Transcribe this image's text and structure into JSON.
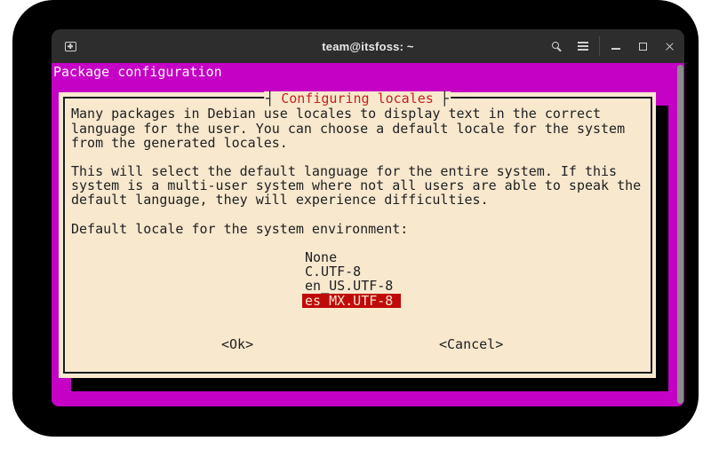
{
  "window": {
    "title": "team@itsfoss: ~",
    "icons": {
      "new_tab": "new-tab-icon",
      "search": "search-icon",
      "menu": "hamburger-menu-icon",
      "minimize": "minimize-icon",
      "maximize": "maximize-icon",
      "close": "close-icon"
    }
  },
  "terminal": {
    "header": "Package configuration",
    "dialog": {
      "title": "Configuring locales",
      "tick_left": "┤",
      "tick_right": "├",
      "body_lines": [
        "Many packages in Debian use locales to display text in the correct",
        "language for the user. You can choose a default locale for the system",
        "from the generated locales.",
        "",
        "This will select the default language for the entire system. If this",
        "system is a multi-user system where not all users are able to speak the",
        "default language, they will experience difficulties.",
        "",
        "Default locale for the system environment:"
      ],
      "options": [
        {
          "label": "None",
          "selected": false
        },
        {
          "label": "C.UTF-8",
          "selected": false
        },
        {
          "label": "en_US.UTF-8",
          "selected": false
        },
        {
          "label": "es_MX.UTF-8",
          "selected": true
        }
      ],
      "ok_label": "<Ok>",
      "cancel_label": "<Cancel>"
    }
  },
  "colors": {
    "backdrop": "#000000",
    "titlebar-bg": "#2d2d2d",
    "titlebar-text": "#e8e8e8",
    "magenta": "#c401c4",
    "header-text": "#fdf8fd",
    "dialog-bg": "#f7e8ce",
    "dialog-border": "#1c1c1c",
    "text-dark": "#212121",
    "title-red": "#c3241c",
    "select-red": "#c00a0a",
    "scrollbar": "#8c8c8c"
  }
}
